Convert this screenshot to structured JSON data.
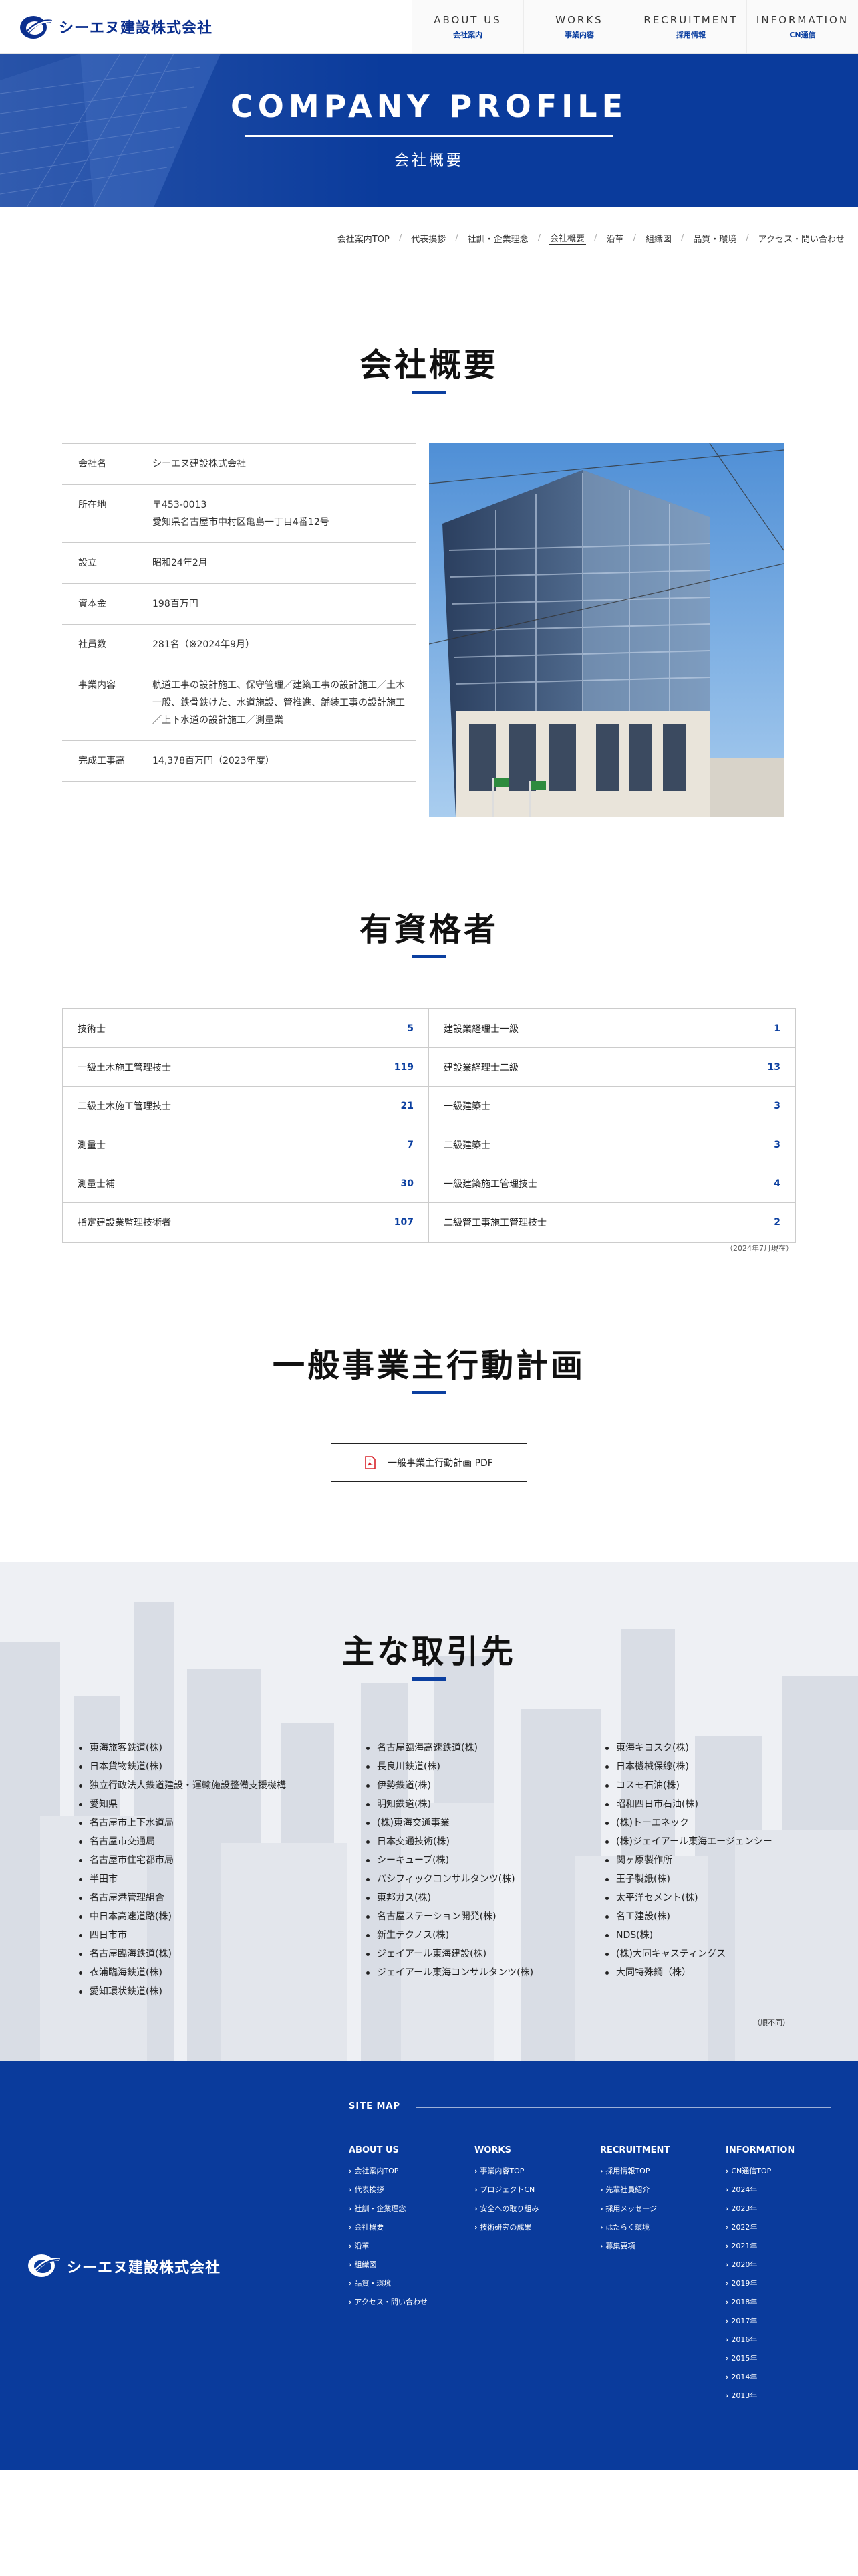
{
  "header": {
    "logo_text": "シーエヌ建設株式会社",
    "nav": [
      {
        "en": "ABOUT US",
        "jp": "会社案内"
      },
      {
        "en": "WORKS",
        "jp": "事業内容"
      },
      {
        "en": "RECRUITMENT",
        "jp": "採用情報"
      },
      {
        "en": "INFORMATION",
        "jp": "CN通信"
      }
    ]
  },
  "hero": {
    "title": "COMPANY PROFILE",
    "subtitle": "会社概要"
  },
  "breadcrumb": [
    "会社案内TOP",
    "代表挨拶",
    "社訓・企業理念",
    "会社概要",
    "沿革",
    "組織図",
    "品質・環境",
    "アクセス・問い合わせ"
  ],
  "profile": {
    "heading": "会社概要",
    "rows": [
      {
        "key": "会社名",
        "value": "シーエヌ建設株式会社"
      },
      {
        "key": "所在地",
        "value": "〒453-0013\n愛知県名古屋市中村区亀島一丁目4番12号"
      },
      {
        "key": "設立",
        "value": "昭和24年2月"
      },
      {
        "key": "資本金",
        "value": "198百万円"
      },
      {
        "key": "社員数",
        "value": "281名（※2024年9月）"
      },
      {
        "key": "事業内容",
        "value": "軌道工事の設計施工、保守管理／建築工事の設計施工／土木一般、鉄骨鉄けた、水道施設、管推進、舗装工事の設計施工／上下水道の設計施工／測量業"
      },
      {
        "key": "完成工事高",
        "value": "14,378百万円（2023年度）"
      }
    ]
  },
  "qualifications": {
    "heading": "有資格者",
    "rows": [
      [
        {
          "name": "技術士",
          "count": "5"
        },
        {
          "name": "建設業経理士一級",
          "count": "1"
        }
      ],
      [
        {
          "name": "一級土木施工管理技士",
          "count": "119"
        },
        {
          "name": "建設業経理士二級",
          "count": "13"
        }
      ],
      [
        {
          "name": "二級土木施工管理技士",
          "count": "21"
        },
        {
          "name": "一級建築士",
          "count": "3"
        }
      ],
      [
        {
          "name": "測量士",
          "count": "7"
        },
        {
          "name": "二級建築士",
          "count": "3"
        }
      ],
      [
        {
          "name": "測量士補",
          "count": "30"
        },
        {
          "name": "一級建築施工管理技士",
          "count": "4"
        }
      ],
      [
        {
          "name": "指定建設業監理技術者",
          "count": "107"
        },
        {
          "name": "二級管工事施工管理技士",
          "count": "2"
        }
      ]
    ],
    "note": "（2024年7月現在）"
  },
  "action_plan": {
    "heading": "一般事業主行動計画",
    "button_label": "一般事業主行動計画 PDF"
  },
  "clients": {
    "heading": "主な取引先",
    "columns": [
      [
        "東海旅客鉄道(株)",
        "日本貨物鉄道(株)",
        "独立行政法人鉄道建設・運輸施設整備支援機構",
        "愛知県",
        "名古屋市上下水道局",
        "名古屋市交通局",
        "名古屋市住宅都市局",
        "半田市",
        "名古屋港管理組合",
        "中日本高速道路(株)",
        "四日市市",
        "名古屋臨海鉄道(株)",
        "衣浦臨海鉄道(株)",
        "愛知環状鉄道(株)"
      ],
      [
        "名古屋臨海高速鉄道(株)",
        "長良川鉄道(株)",
        "伊勢鉄道(株)",
        "明知鉄道(株)",
        "(株)東海交通事業",
        "日本交通技術(株)",
        "シーキューブ(株)",
        "パシフィックコンサルタンツ(株)",
        "東邦ガス(株)",
        "名古屋ステーション開発(株)",
        "新生テクノス(株)",
        "ジェイアール東海建設(株)",
        "ジェイアール東海コンサルタンツ(株)"
      ],
      [
        "東海キヨスク(株)",
        "日本機械保線(株)",
        "コスモ石油(株)",
        "昭和四日市石油(株)",
        "(株)トーエネック",
        "(株)ジェイアール東海エージェンシー",
        "関ヶ原製作所",
        "王子製紙(株)",
        "太平洋セメント(株)",
        "名工建設(株)",
        "NDS(株)",
        "(株)大同キャスティングス",
        "大同特殊鋼（株）"
      ]
    ],
    "note": "（順不同）"
  },
  "footer": {
    "logo_text": "シーエヌ建設株式会社",
    "sitemap_label": "SITE MAP",
    "columns": [
      {
        "heading": "ABOUT US",
        "links": [
          "会社案内TOP",
          "代表挨拶",
          "社訓・企業理念",
          "会社概要",
          "沿革",
          "組織図",
          "品質・環境",
          "アクセス・問い合わせ"
        ]
      },
      {
        "heading": "WORKS",
        "links": [
          "事業内容TOP",
          "プロジェクトCN",
          "安全への取り組み",
          "技術研究の成果"
        ]
      },
      {
        "heading": "RECRUITMENT",
        "links": [
          "採用情報TOP",
          "先輩社員紹介",
          "採用メッセージ",
          "はたらく環境",
          "募集要項"
        ]
      },
      {
        "heading": "INFORMATION",
        "links": [
          "CN通信TOP",
          "2024年",
          "2023年",
          "2022年",
          "2021年",
          "2020年",
          "2019年",
          "2018年",
          "2017年",
          "2016年",
          "2015年",
          "2014年",
          "2013年"
        ]
      }
    ]
  },
  "colors": {
    "brand_blue": "#0a3b9c",
    "accent": "#0b3fa0",
    "pdf_red": "#d8232a"
  }
}
